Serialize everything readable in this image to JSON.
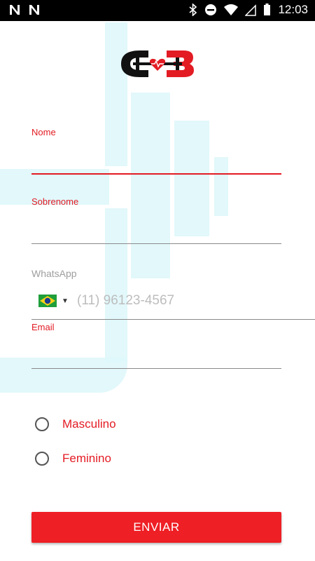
{
  "status_bar": {
    "time": "12:03",
    "left_icons": [
      "n-notification-icon",
      "n-notification-icon"
    ],
    "right_icons": [
      "bluetooth-icon",
      "do-not-disturb-icon",
      "wifi-icon",
      "signal-icon",
      "battery-icon"
    ]
  },
  "form": {
    "fields": [
      {
        "label": "Nome",
        "value": ""
      },
      {
        "label": "Sobrenome",
        "value": ""
      }
    ],
    "whatsapp": {
      "label": "WhatsApp",
      "country": "BR",
      "placeholder": "(11) 96123-4567"
    },
    "email": {
      "label": "Email",
      "value": ""
    },
    "gender_options": [
      "Masculino",
      "Feminino"
    ],
    "submit_label": "ENVIAR"
  },
  "colors": {
    "accent": "#e31b23",
    "button": "#ee1f25",
    "background_shape": "#dff7fb"
  }
}
